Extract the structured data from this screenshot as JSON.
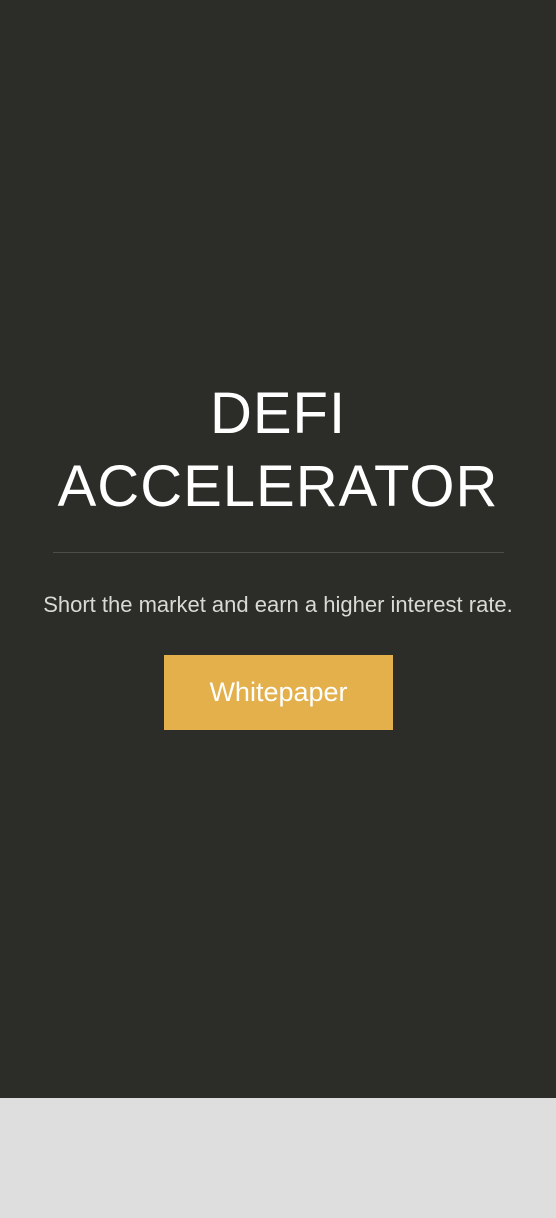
{
  "hero": {
    "title_line1": "DEFI",
    "title_line2": "ACCELERATOR",
    "tagline": "Short the market and earn a higher interest rate.",
    "button_label": "Whitepaper"
  },
  "colors": {
    "hero_background": "#2c2d29",
    "accent": "#e3b04b",
    "page_background": "#dedede",
    "text_primary": "#ffffff"
  }
}
